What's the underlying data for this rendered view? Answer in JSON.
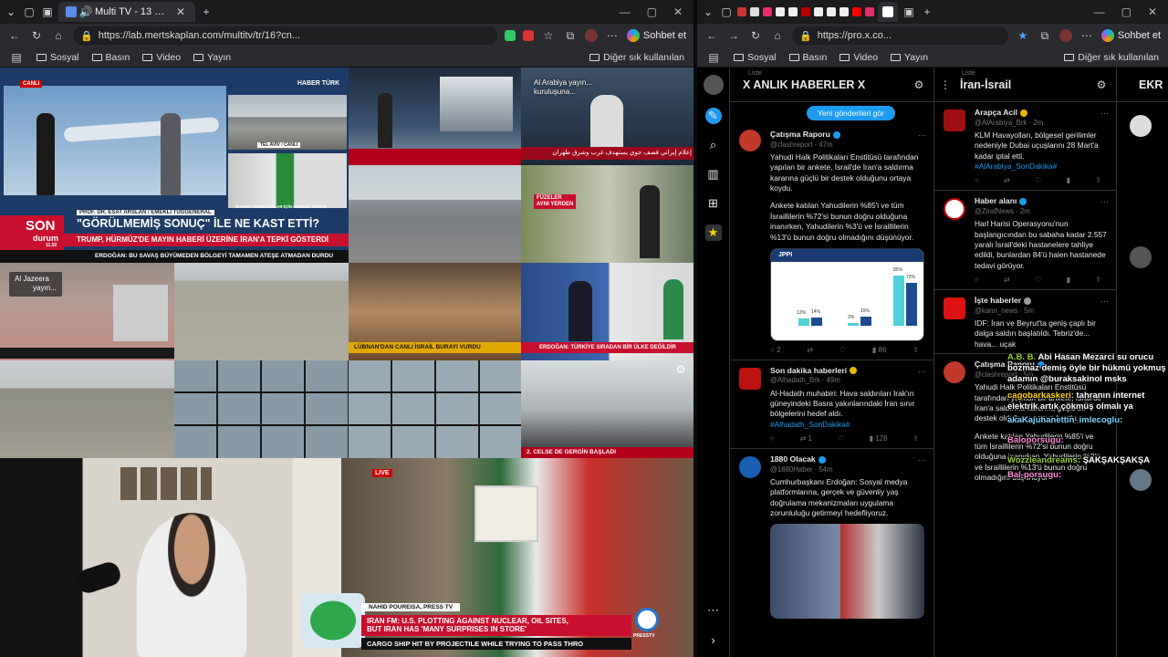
{
  "left_window": {
    "tab_title": "Multi TV - 13 haber kanalını a",
    "url": "https://lab.mertskaplan.com/multitv/tr/16?cn...",
    "profile_button": "Sohbet et",
    "bookmarks": [
      "Sosyal",
      "Basın",
      "Video",
      "Yayın"
    ],
    "bookmarks_other": "Diğer sık kullanılan"
  },
  "right_window": {
    "url": "https://pro.x.co...",
    "profile_button": "Sohbet et",
    "bookmarks": [
      "Sosyal",
      "Basın",
      "Video",
      "Yayın"
    ],
    "bookmarks_other": "Diğer sık kullanılan"
  },
  "tv": {
    "ch1_brand": "HABER TÜRK",
    "ch1_live": "CANLI",
    "ch1_sub": "TEL AVİV / CANLI",
    "ch1_guest": "PROF. DR. ESAT ARSLAN / EMEKLİ TUĞGENERAL",
    "ch1_son": "SON",
    "ch1_durum": "durum",
    "ch1_clock": "11.50",
    "ch1_headline": "\"GÖRÜLMEMİŞ SONUÇ\" İLE NE KAST ETTİ?",
    "ch1_sub_headline": "TRUMP, HÜRMÜZ'DE MAYIN HABERİ ÜZERİNE İRAN'A TEPKİ GÖSTERDİ",
    "ch1_ticker": "ERDOĞAN: BU SAVAŞ BÜYÜMEDEN BÖLGEYİ TAMAMEN ATEŞE ATMADAN DURDU",
    "ch1_mini": "İRAN'DA KOMUTANLAR İÇİN CENAZE TÖRENİ",
    "ch3_banner": "إعلام إيراني قصف جوي يستهدف غرب وشرق طهران",
    "ch4_title": "Al Arabiya yayın...",
    "ch4_subtitle": "kuruluşuna...",
    "ch5_badge": "FÜZELER",
    "ch5_badge2": "AYNI YERDEN",
    "ch6_title": "Al Jazeera",
    "ch6_subtitle": "yayın...",
    "ch7_banner": "LÜBNAN'DAN CANLI İSRAİL BURAYI VURDU",
    "ch8_banner": "ERDOĞAN: TÜRKİYE SIRADAN BİR ÜLKE DEĞİLDİR",
    "ch9_banner": "2. CELSE DE GERGİN BAŞLADI"
  },
  "stream": {
    "live_badge": "LIVE",
    "reporter": "NAHID POUREISA, PRESS TV",
    "headline_1": "IRAN FM: U.S. PLOTTING AGAINST NUCLEAR, OIL SITES,",
    "headline_2": "BUT IRAN HAS 'MANY SURPRISES IN STORE'",
    "ticker": "CARGO SHIP HIT BY PROJECTILE WHILE TRYING TO PASS THRO",
    "channel_logo": "PRESSTV"
  },
  "deck": {
    "col1": {
      "list_label": "Liste",
      "title": "X ANLIK HABERLER X",
      "new_posts": "Yeni gönderileri gör",
      "tweets": [
        {
          "name": "Çatışma Raporu",
          "handle": "@clashreport · 47m",
          "body": "Yahudi Halk Politikaları Enstitüsü tarafından yapılan bir ankete, İsrail'de İran'a saldırma kararına güçlü bir destek olduğunu ortaya koydu.",
          "body2": "Ankete katılan Yahudilerin %85'i ve tüm İsraillilerin %72'si bunun doğru olduğuna inanırken, Yahudilerin %3'ü ve İsraillilerin %13'ü bunun doğru olmadığını düşünüyor.",
          "card_brand": "JPPI",
          "card_values": [
            "12%",
            "14%",
            "3%",
            "15%",
            "85%",
            "72%"
          ],
          "replies": "2",
          "likes": "86"
        },
        {
          "name": "Son dakika haberleri",
          "handle": "@Alhadath_Brk · 49m",
          "body": "Al-Hadath muhabiri: Hava saldırıları Irak'ın güneyindeki Basra yakınlarındaki İran sınır bölgelerini hedef aldı.",
          "link": "#Alhadath_SonDakika#",
          "retweets": "1",
          "likes": "128"
        },
        {
          "name": "1880 Olacak",
          "handle": "@1880Haber · 54m",
          "body": "Cumhurbaşkanı Erdoğan: Sosyal medya platformlarına, gerçek ve güvenliy yaş doğrulama mekanizmaları uygulama zorunluluğu getirmeyi hedefliyoruz."
        }
      ]
    },
    "col2": {
      "list_label": "Liste",
      "title": "İran-İsrail",
      "tweets": [
        {
          "name": "Arapça Acil",
          "handle": "@AlArabiya_Brk · 2m",
          "body": "KLM Havayolları, bölgesel gerilimler nedeniyle Dubai uçuşlarını 28 Mart'a kadar iptal etti.",
          "link": "#AlArabiya_SonDakika#"
        },
        {
          "name": "Haber alanı",
          "handle": "@ZirafNews · 2m",
          "body": "Harl Harisi Operasyonu'nun başlangıcından bu sabaha kadar 2.557 yaralı İsrail'deki hastanelere tahliye edildi, bunlardan 84'ü halen hastanede tedavi görüyor."
        },
        {
          "name": "İşte haberler",
          "handle": "@kann_news · 5m",
          "body": "IDF: İran ve Beyrut'ta geniş çaplı bir dalga saldırı başlatıldı. Tebriz'de... hava... uçak"
        },
        {
          "name": "Çatışma Raporu",
          "handle": "@clashreport · 5m",
          "body": "Yahudi Halk Politikaları Enstitüsü tarafından yapılan bir ankete, İsrail'de İran'a saldırma kararına güçlü bir destek olduğunu ortaya koydu.",
          "body2": "Ankete katılan Yahudilerin %85'i ve tüm İsraillilerin %72'si bunun doğru olduğuna inanırken, Yahudilerin %3'ü ve İsraillilerin %13'ü bunun doğru olmadığını düşünüyor."
        }
      ]
    },
    "col3": {
      "title": "EKR"
    }
  },
  "chat": [
    {
      "user": "A.B. B.",
      "message": "Abi Hasan Mezarci su orucu bozmaz demiş öyle bir hükmü yokmuş adamın @buraksakinol msks"
    },
    {
      "user": "cagobarkaskeri:",
      "message": "tahranın internet elektrik artık çökmüş olmalı ya"
    },
    {
      "user": "akaKajuhanettin_imlecoglu:",
      "message": ""
    },
    {
      "user": "Baloporsugu:",
      "message": ""
    },
    {
      "user": "Wozzleandreams:",
      "message": "ŞAKŞAKŞAKŞA"
    },
    {
      "user": "Bal-porsugu:",
      "message": ""
    }
  ]
}
